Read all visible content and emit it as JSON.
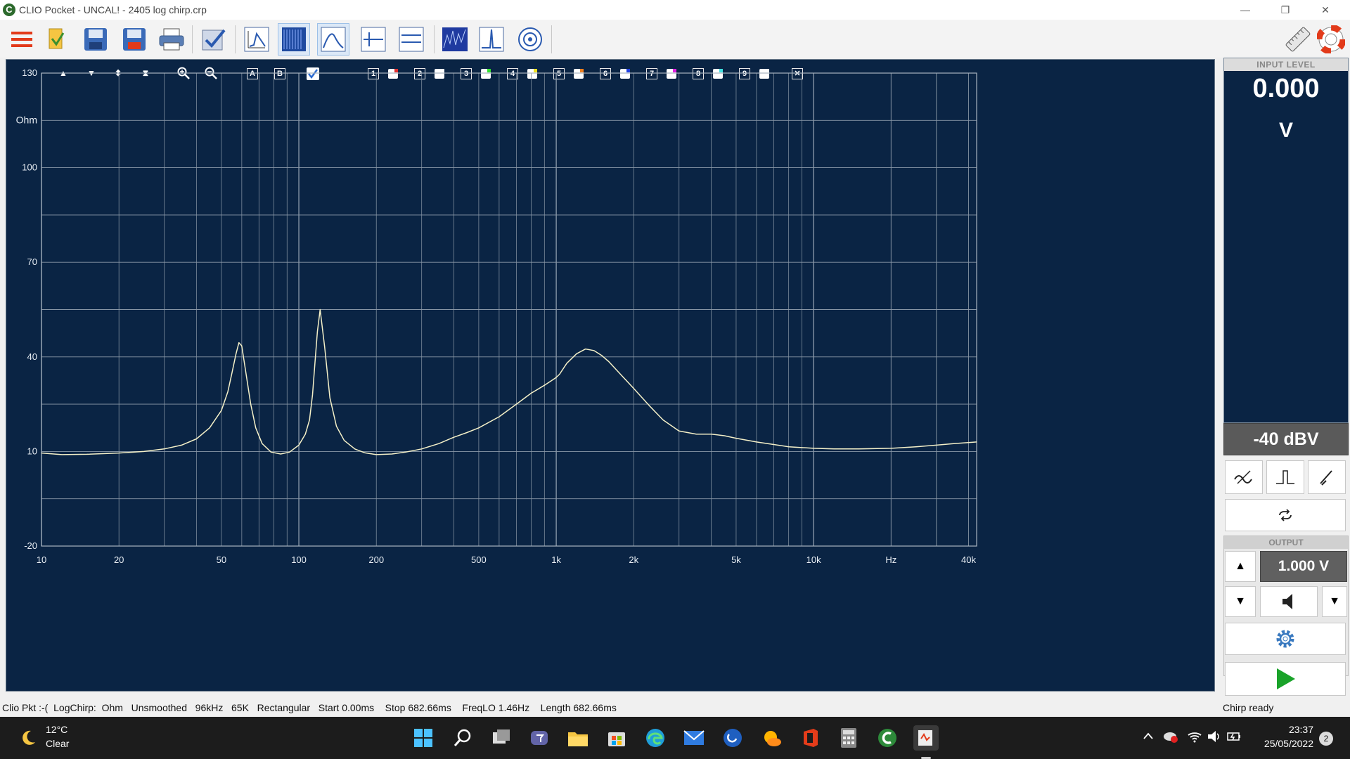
{
  "window": {
    "title": "CLIO Pocket - UNCAL! - 2405 log chirp.crp",
    "app_icon_letter": "C",
    "controls": {
      "minimize": "—",
      "maximize": "❐",
      "close": "✕"
    }
  },
  "toolbar": {
    "icons": [
      "menu-icon",
      "open-folder-icon",
      "save-icon",
      "save-as-icon",
      "print-icon",
      "check-icon",
      "graph-icon",
      "spectrum-icon",
      "curve-icon",
      "marker-icon",
      "overlay-icon",
      "waterfall-icon",
      "impulse-icon",
      "polar-icon",
      "ruler-icon",
      "help-lifebuoy-icon"
    ]
  },
  "plot_toolbar": {
    "buttons": [
      "▲",
      "▼",
      "⬍",
      "⧗"
    ],
    "zoom": [
      "zoom-in-icon",
      "zoom-out-icon"
    ],
    "A": "A",
    "B": "B",
    "overlays": [
      {
        "num": "1",
        "color": "#e03030"
      },
      {
        "num": "2",
        "color": "#ffffff"
      },
      {
        "num": "3",
        "color": "#30e030"
      },
      {
        "num": "4",
        "color": "#f0e020"
      },
      {
        "num": "5",
        "color": "#f08020"
      },
      {
        "num": "6",
        "color": "#2040e0"
      },
      {
        "num": "7",
        "color": "#e020e0"
      },
      {
        "num": "8",
        "color": "#40e0e0"
      },
      {
        "num": "9",
        "color": "#ffffff"
      }
    ],
    "close": "✕"
  },
  "chart_data": {
    "type": "line",
    "title": "",
    "xlabel": "Hz",
    "ylabel": "Ohm",
    "x_scale": "log",
    "xlim": [
      10,
      43000
    ],
    "ylim": [
      -20,
      130
    ],
    "y_ticks": [
      130,
      100,
      70,
      40,
      10,
      -20
    ],
    "x_ticks": [
      10,
      20,
      50,
      100,
      200,
      500,
      1000,
      2000,
      5000,
      10000,
      40000
    ],
    "x_tick_labels": [
      "10",
      "20",
      "50",
      "100",
      "200",
      "500",
      "1k",
      "2k",
      "5k",
      "10k",
      "40k"
    ],
    "grid": true,
    "line_color": "#f4f0c8",
    "background": "#0a2444",
    "series": [
      {
        "x": [
          10,
          12,
          15,
          20,
          25,
          30,
          35,
          40,
          45,
          50,
          53,
          55,
          57,
          58.5,
          60,
          62,
          65,
          68,
          72,
          78,
          85,
          92,
          100,
          106,
          110,
          113,
          115.5,
          118,
          121,
          126,
          132,
          140,
          150,
          165,
          180,
          200,
          230,
          260,
          300,
          350,
          400,
          450,
          500,
          600,
          700,
          800,
          900,
          980,
          1000,
          1030,
          1100,
          1200,
          1300,
          1400,
          1500,
          1600,
          1800,
          2000,
          2300,
          2600,
          3000,
          3500,
          4000,
          4500,
          5000,
          6000,
          7000,
          8000,
          10000,
          12000,
          15000,
          20000,
          25000,
          30000,
          35000,
          43000
        ],
        "y": [
          9.5,
          9.0,
          9.1,
          9.5,
          10.0,
          10.8,
          12.0,
          14.0,
          17.5,
          23.0,
          29.0,
          35.0,
          41.0,
          44.5,
          43.5,
          36.0,
          25.0,
          17.5,
          12.5,
          9.8,
          9.2,
          9.8,
          12.0,
          15.5,
          20.0,
          28.0,
          38.0,
          48.0,
          55.0,
          43.0,
          27.0,
          18.0,
          13.5,
          10.8,
          9.6,
          9.0,
          9.2,
          9.8,
          10.8,
          12.5,
          14.5,
          16.0,
          17.5,
          21.0,
          25.0,
          28.5,
          31.0,
          33.0,
          33.5,
          34.5,
          38.0,
          41.0,
          42.5,
          42.0,
          40.5,
          38.5,
          34.0,
          30.0,
          24.5,
          20.0,
          16.5,
          15.5,
          15.5,
          15.0,
          14.2,
          13.0,
          12.2,
          11.5,
          11.0,
          10.8,
          10.8,
          11.0,
          11.5,
          12.0,
          12.5,
          13.0
        ]
      }
    ]
  },
  "input_level": {
    "label": "INPUT LEVEL",
    "value": "0.000",
    "unit": "V",
    "range": "-40 dBV",
    "mode_icons": [
      "ac-coupling-icon",
      "impulse-mode-icon",
      "probe-icon"
    ],
    "loop_icon": "loop-icon"
  },
  "output": {
    "label": "OUTPUT",
    "value": "1.000 V",
    "up_icon": "▲",
    "down_icon": "▼",
    "speaker_icon": "speaker-icon",
    "dropdown_icon": "▼"
  },
  "settings_icon": "gear-icon",
  "play_icon": "play-icon",
  "status": {
    "left": "Clio Pkt :-(  LogChirp:  Ohm   Unsmoothed   96kHz   65K   Rectangular   Start 0.00ms    Stop 682.66ms    FreqLO 1.46Hz    Length 682.66ms",
    "right": "Chirp ready"
  },
  "taskbar": {
    "weather_temp": "12°C",
    "weather_text": "Clear",
    "time": "23:37",
    "date": "25/05/2022",
    "notification_count": "2",
    "apps": [
      "windows-start-icon",
      "search-icon",
      "task-view-icon",
      "teams-icon",
      "file-explorer-icon",
      "store-icon",
      "edge-icon",
      "mail-icon",
      "app-icon",
      "weather-app-icon",
      "office-icon",
      "calculator-icon",
      "clio-icon",
      "active-app-icon"
    ]
  }
}
